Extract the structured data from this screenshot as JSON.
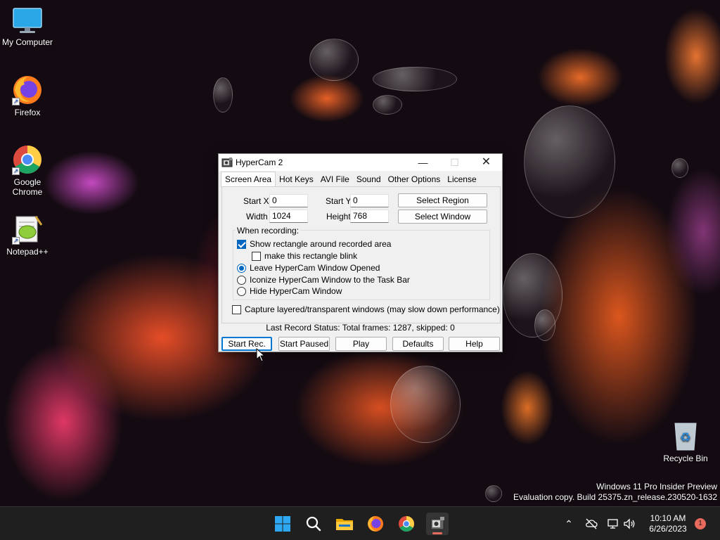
{
  "desktop": {
    "icons": [
      {
        "label": "My Computer"
      },
      {
        "label": "Firefox"
      },
      {
        "label": "Google Chrome"
      },
      {
        "label": "Notepad++"
      },
      {
        "label": "Recycle Bin"
      }
    ],
    "watermark": {
      "line1": "Windows 11 Pro Insider Preview",
      "line2": "Evaluation copy. Build 25375.zn_release.230520-1632"
    }
  },
  "window": {
    "title": "HyperCam 2",
    "tabs": [
      {
        "label": "Screen Area",
        "active": true
      },
      {
        "label": "Hot Keys"
      },
      {
        "label": "AVI File"
      },
      {
        "label": "Sound"
      },
      {
        "label": "Other Options"
      },
      {
        "label": "License"
      }
    ],
    "screen_area": {
      "start_x_label": "Start X",
      "start_x_value": "0",
      "start_y_label": "Start Y",
      "start_y_value": "0",
      "width_label": "Width",
      "width_value": "1024",
      "height_label": "Height",
      "height_value": "768",
      "select_region_label": "Select Region",
      "select_window_label": "Select Window",
      "group_title": "When recording:",
      "show_rectangle_label": "Show rectangle around recorded area",
      "show_rectangle_checked": true,
      "blink_label": "make this rectangle blink",
      "blink_checked": false,
      "radio_leave_label": "Leave HyperCam Window Opened",
      "radio_iconize_label": "Iconize HyperCam Window to the Task Bar",
      "radio_hide_label": "Hide HyperCam Window",
      "radio_selected": "leave",
      "capture_layered_label": "Capture layered/transparent windows (may slow down performance)",
      "capture_layered_checked": false
    },
    "status_text": "Last Record Status: Total frames: 1287, skipped: 0",
    "buttons": {
      "start_rec": "Start Rec.",
      "start_paused": "Start Paused",
      "play": "Play",
      "defaults": "Defaults",
      "help": "Help"
    }
  },
  "taskbar": {
    "time": "10:10 AM",
    "date": "6/26/2023",
    "notification_count": "1"
  },
  "colors": {
    "accent": "#0067c0",
    "focus_border": "#0078d4",
    "taskbar": "#1f1f1f",
    "notification": "#e86a5c"
  }
}
